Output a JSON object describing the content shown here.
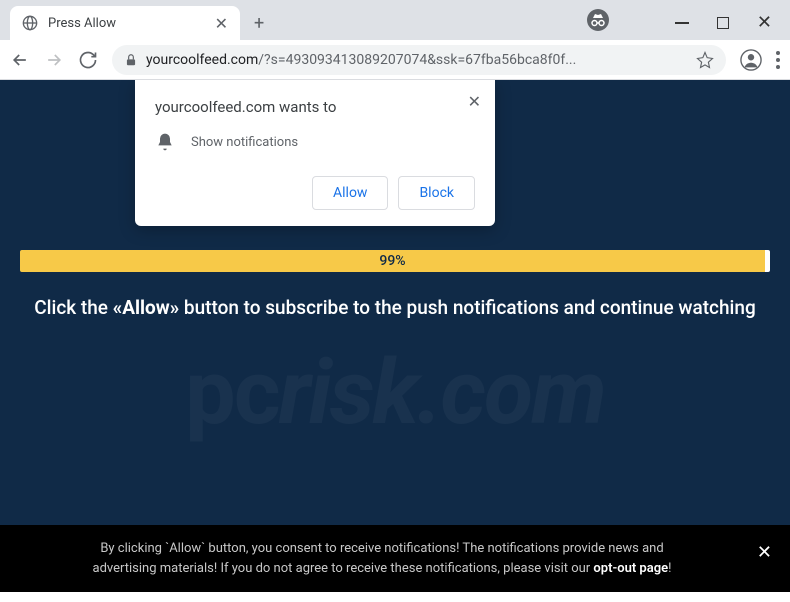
{
  "tab": {
    "title": "Press Allow"
  },
  "address": {
    "host": "yourcoolfeed.com",
    "path": "/?s=493093413089207074&ssk=67fba56bca8f0f..."
  },
  "prompt": {
    "origin_text": "yourcoolfeed.com wants to",
    "permission_text": "Show notifications",
    "allow_label": "Allow",
    "block_label": "Block"
  },
  "progress": {
    "percent_text": "99%"
  },
  "instruction": {
    "prefix": "Click the ",
    "bold": "«Allow»",
    "suffix": " button to subscribe to the push notifications and continue watching"
  },
  "banner": {
    "line1": "By clicking `Allow` button, you consent to receive notifications! The notifications provide news and",
    "line2_prefix": "advertising materials! If you do not agree to receive these notifications, please visit our ",
    "optout_label": "opt-out page",
    "line2_suffix": "!"
  },
  "watermark": {
    "text": "pcrisk.com"
  }
}
